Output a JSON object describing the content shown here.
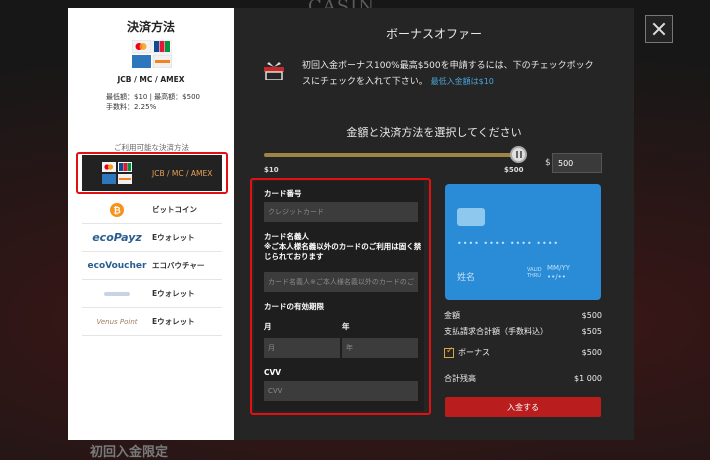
{
  "site": {
    "brand": "CASIN",
    "bottom_banner": "初回入金限定"
  },
  "payment_panel": {
    "title": "決済方法",
    "selected_method": {
      "name": "JCB / MC / AMEX",
      "limit": "最低額：$10 | 最高額：$500",
      "fee": "手数料：2.25%"
    },
    "available_label": "ご利用可能な決済方法",
    "methods": [
      {
        "label": "JCB / MC / AMEX",
        "logo_text": "",
        "icon": "card-logos-icon",
        "selected": true
      },
      {
        "label": "ビットコイン",
        "logo_text": "",
        "icon": "bitcoin-icon",
        "selected": false
      },
      {
        "label": "Eウォレット",
        "logo_text": "ecoPayz",
        "icon": "ecopayz-logo-icon",
        "selected": false
      },
      {
        "label": "エコバウチャー",
        "logo_text": "ecoVoucher",
        "icon": "ecovoucher-logo-icon",
        "selected": false
      },
      {
        "label": "Eウォレット",
        "logo_text": "",
        "icon": "ewallet-logo-icon",
        "selected": false
      },
      {
        "label": "Eウォレット",
        "logo_text": "Venus Point",
        "icon": "venuspoint-logo-icon",
        "selected": false
      }
    ]
  },
  "bonus": {
    "title": "ボーナスオファー",
    "description": "初回入金ボーナス100%最高$500を申請するには、下のチェックボックスにチェックを入れて下さい。",
    "min_note": "最低入金額は$10"
  },
  "amount": {
    "title": "金額と決済方法を選択してください",
    "slider_min": "$10",
    "slider_max": "$500",
    "slider_value_fraction": 1.0,
    "currency_symbol": "$",
    "value": "500"
  },
  "card_form": {
    "number_label": "カード番号",
    "number_placeholder": "クレジットカード",
    "name_label": "カード名義人",
    "name_note": "※ご本人様名義以外のカードのご利用は固く禁じられております",
    "name_placeholder": "カード名義人※ご本人様名義以外のカードのご",
    "expiry_label": "カードの有効期限",
    "month_label": "月",
    "year_label": "年",
    "month_placeholder": "月",
    "year_placeholder": "年",
    "cvv_label": "CVV",
    "cvv_placeholder": "CVV"
  },
  "card_preview": {
    "number_mask": "•••• •••• •••• ••••",
    "name": "姓名",
    "valid_thru_line1": "VALID",
    "valid_thru_line2": "THRU",
    "expiry_format": "MM/YY",
    "expiry_mask": "••/••"
  },
  "summary": {
    "amount_label": "金額",
    "amount_value": "$500",
    "total_label": "支払請求合計額（手数料込）",
    "total_value": "$505",
    "bonus_label": "ボーナス",
    "bonus_value": "$500",
    "bonus_checked": true,
    "balance_label": "合計残高",
    "balance_value": "$1 000"
  },
  "deposit_button": "入金する",
  "colors": {
    "accent_gold": "#d9a640",
    "card_blue": "#2a8bd6",
    "deposit_red": "#b91d1d",
    "highlight_red": "#e21010",
    "link_blue": "#4aa3d8"
  }
}
